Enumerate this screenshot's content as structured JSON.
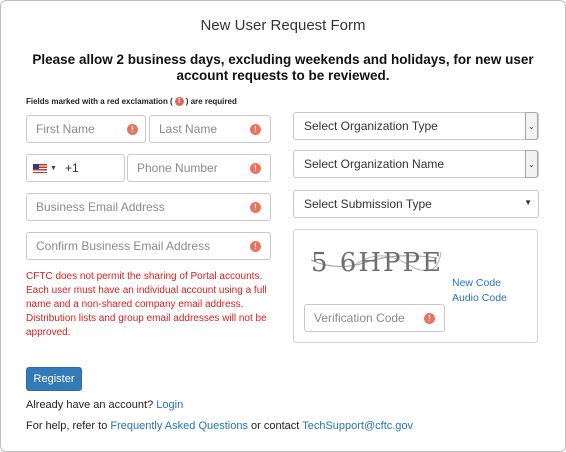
{
  "form": {
    "title": "New User Request Form",
    "notice": "Please allow 2 business days, excluding weekends and holidays, for new user account requests to be reviewed.",
    "required_note_prefix": "Fields marked with a red exclamation (",
    "required_note_suffix": ") are required"
  },
  "fields": {
    "first_name": "First Name",
    "last_name": "Last Name",
    "country_code": "+1",
    "phone": "Phone Number",
    "email": "Business Email Address",
    "confirm_email": "Confirm Business Email Address",
    "verification": "Verification Code"
  },
  "selects": {
    "organization_type": "Select Organization Type",
    "organization_name": "Select Organization Name",
    "submission_type": "Select Submission Type"
  },
  "disclaimer": "CFTC does not permit the sharing of Portal accounts. Each user must have an individual account using a full name and a non-shared company email address. Distribution lists and group email addresses will not be approved.",
  "captcha": {
    "image_text": "5 6HPPE",
    "new_code": "New Code",
    "audio_code": "Audio Code"
  },
  "actions": {
    "register": "Register",
    "have_account": "Already have an account?",
    "login": "Login",
    "help_prefix": "For help, refer to",
    "faq": "Frequently Asked Questions",
    "help_middle": "or contact",
    "support_email": "TechSupport@cftc.gov"
  },
  "colors": {
    "accent": "#337ab7",
    "link": "#2a72b5",
    "error": "#d42020",
    "warning_icon": "#e8755f"
  },
  "icons": {
    "required": "exclamation-circle-icon",
    "flag": "us-flag-icon",
    "dropdown": "chevron-down-icon"
  }
}
